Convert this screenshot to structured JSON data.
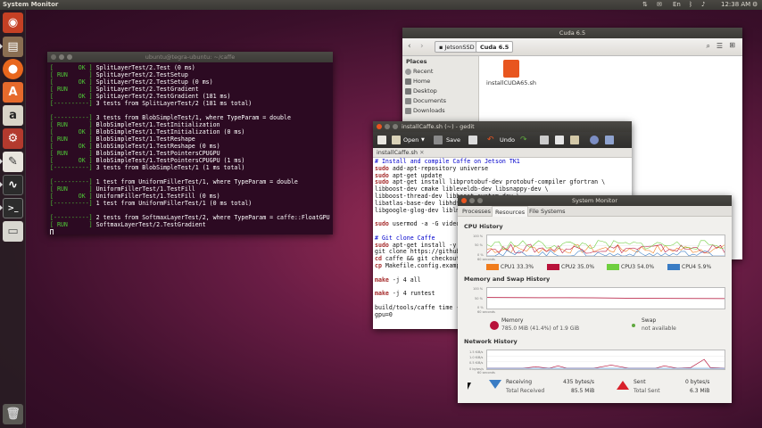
{
  "top_panel": {
    "app_title": "System Monitor",
    "keyboard": "En",
    "clock": "12:38 AM"
  },
  "launcher": {
    "items": [
      "Dash",
      "Files",
      "Firefox",
      "Ubuntu Software Center",
      "Amazon",
      "System Settings",
      "Text Editor",
      "System Monitor",
      "Terminal",
      "Drive",
      "Trash"
    ]
  },
  "terminal": {
    "title": "ubuntu@tegra-ubuntu: ~/caffe",
    "lines": [
      {
        "status": "[       OK ]",
        "text": " SplitLayerTest/2.Test (0 ms)"
      },
      {
        "status": "[ RUN      ]",
        "text": " SplitLayerTest/2.TestSetup"
      },
      {
        "status": "[       OK ]",
        "text": " SplitLayerTest/2.TestSetup (0 ms)"
      },
      {
        "status": "[ RUN      ]",
        "text": " SplitLayerTest/2.TestGradient"
      },
      {
        "status": "[       OK ]",
        "text": " SplitLayerTest/2.TestGradient (181 ms)"
      },
      {
        "status": "[----------]",
        "text": " 3 tests from SplitLayerTest/2 (181 ms total)"
      },
      {
        "status": "",
        "text": ""
      },
      {
        "status": "[----------]",
        "text": " 3 tests from BlobSimpleTest/1, where TypeParam = double"
      },
      {
        "status": "[ RUN      ]",
        "text": " BlobSimpleTest/1.TestInitialization"
      },
      {
        "status": "[       OK ]",
        "text": " BlobSimpleTest/1.TestInitialization (0 ms)"
      },
      {
        "status": "[ RUN      ]",
        "text": " BlobSimpleTest/1.TestReshape"
      },
      {
        "status": "[       OK ]",
        "text": " BlobSimpleTest/1.TestReshape (0 ms)"
      },
      {
        "status": "[ RUN      ]",
        "text": " BlobSimpleTest/1.TestPointersCPUGPU"
      },
      {
        "status": "[       OK ]",
        "text": " BlobSimpleTest/1.TestPointersCPUGPU (1 ms)"
      },
      {
        "status": "[----------]",
        "text": " 3 tests from BlobSimpleTest/1 (1 ms total)"
      },
      {
        "status": "",
        "text": ""
      },
      {
        "status": "[----------]",
        "text": " 1 test from UniformFillerTest/1, where TypeParam = double"
      },
      {
        "status": "[ RUN      ]",
        "text": " UniformFillerTest/1.TestFill"
      },
      {
        "status": "[       OK ]",
        "text": " UniformFillerTest/1.TestFill (0 ms)"
      },
      {
        "status": "[----------]",
        "text": " 1 test from UniformFillerTest/1 (0 ms total)"
      },
      {
        "status": "",
        "text": ""
      },
      {
        "status": "[----------]",
        "text": " 2 tests from SoftmaxLayerTest/2, where TypeParam = caffe::FloatGPU"
      },
      {
        "status": "[ RUN      ]",
        "text": " SoftmaxLayerTest/2.TestGradient"
      }
    ]
  },
  "files": {
    "title": "Cuda 6.5",
    "breadcrumb": [
      "JetsonSSD",
      "Cuda 6.5"
    ],
    "places_header": "Places",
    "places": [
      "Recent",
      "Home",
      "Desktop",
      "Documents",
      "Downloads"
    ],
    "file_name": "installCUDA65.sh"
  },
  "gedit": {
    "title": "installCaffe.sh (~) - gedit",
    "toolbar": {
      "open": "Open",
      "save": "Save",
      "undo": "Undo"
    },
    "tab": "installCaffe.sh",
    "lines": [
      {
        "type": "comment",
        "text": "# Install and compile Caffe on Jetson TK1"
      },
      {
        "type": "cmd",
        "kw": "sudo",
        "text": " add-apt-repository universe"
      },
      {
        "type": "cmd",
        "kw": "sudo",
        "text": " apt-get update"
      },
      {
        "type": "cmd",
        "kw": "sudo",
        "text": " apt-get install libprotobuf-dev protobuf-compiler gfortran \\"
      },
      {
        "type": "plain",
        "text": "libboost-dev cmake libleveldb-dev libsnappy-dev \\"
      },
      {
        "type": "plain",
        "text": "libboost-thread-dev libboost-system-dev \\"
      },
      {
        "type": "plain",
        "text": "libatlas-base-dev libhdf5-serial-dev libgflags-dev \\"
      },
      {
        "type": "plain",
        "text": "libgoogle-glog-dev liblmdb-dev -y"
      },
      {
        "type": "plain",
        "text": ""
      },
      {
        "type": "cmd",
        "kw": "sudo",
        "text": " usermod -a -G video $USER"
      },
      {
        "type": "plain",
        "text": ""
      },
      {
        "type": "comment",
        "text": "# Git clone Caffe"
      },
      {
        "type": "cmd",
        "kw": "sudo",
        "text": " apt-get install -y git"
      },
      {
        "type": "plain",
        "text": "git clone https://github.com/BVLC/caffe.git"
      },
      {
        "type": "cmd",
        "kw": "cd",
        "text": " caffe && git checkout dev"
      },
      {
        "type": "cmd",
        "kw": "cp",
        "text": " Makefile.config.example Makefile.config"
      },
      {
        "type": "plain",
        "text": ""
      },
      {
        "type": "cmd",
        "kw": "make",
        "text": " -j 4 all"
      },
      {
        "type": "plain",
        "text": ""
      },
      {
        "type": "cmd",
        "kw": "make",
        "text": " -j 4 runtest"
      },
      {
        "type": "plain",
        "text": ""
      },
      {
        "type": "plain",
        "text": "build/tools/caffe time --model=models/bvlc_alexnet/deploy.prototxt \\"
      },
      {
        "type": "plain",
        "text": "gpu=0"
      }
    ]
  },
  "sysmon": {
    "title": "System Monitor",
    "tabs": [
      "Processes",
      "Resources",
      "File Systems"
    ],
    "cpu": {
      "title": "CPU History",
      "y_labels": [
        "100 %",
        "50 %",
        "0 %"
      ],
      "x_label": "60 seconds",
      "cores": [
        {
          "label": "CPU1",
          "value": "33.3%",
          "color": "#f07c1c"
        },
        {
          "label": "CPU2",
          "value": "35.0%",
          "color": "#b8123a"
        },
        {
          "label": "CPU3",
          "value": "54.0%",
          "color": "#6fcf3f"
        },
        {
          "label": "CPU4",
          "value": "5.9%",
          "color": "#3a7cc4"
        }
      ]
    },
    "memory": {
      "title": "Memory and Swap History",
      "y_labels": [
        "100 %",
        "50 %",
        "0 %"
      ],
      "x_label": "60 seconds",
      "mem_label": "Memory",
      "mem_value": "785.0 MiB (41.4%) of 1.9 GiB",
      "swap_label": "Swap",
      "swap_value": "not available"
    },
    "network": {
      "title": "Network History",
      "y_labels": [
        "1.5 KiB/s",
        "1.0 KiB/s",
        "0.5 KiB/s",
        "0 bytes/s"
      ],
      "x_label": "60 seconds",
      "receiving_label": "Receiving",
      "receiving_rate": "435 bytes/s",
      "total_received_label": "Total Received",
      "total_received": "85.5 MiB",
      "sent_label": "Sent",
      "sent_rate": "0 bytes/s",
      "total_sent_label": "Total Sent",
      "total_sent": "6.3 MiB"
    }
  }
}
